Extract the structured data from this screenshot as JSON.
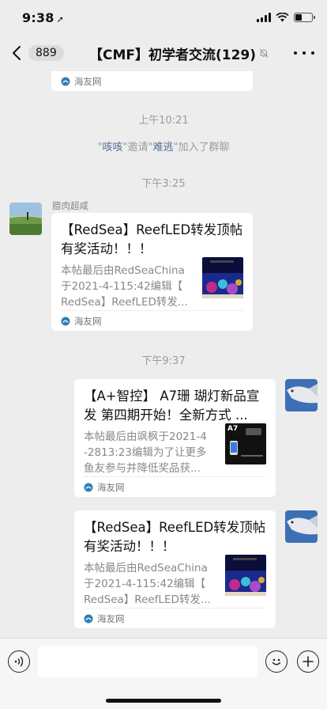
{
  "status_bar": {
    "time": "9:38",
    "location_arrow": "➚"
  },
  "nav": {
    "unread_count": "889",
    "title": "【CMF】初学者交流(129)"
  },
  "chat": {
    "messages": [
      {
        "type": "link_card_footer",
        "source": "海友网"
      },
      {
        "type": "timestamp",
        "text": "上午10:21"
      },
      {
        "type": "system",
        "q1": "\"",
        "inviter": "咳咳",
        "mid": "\"邀请\"",
        "invitee": "难逃",
        "end": "\"加入了群聊"
      },
      {
        "type": "timestamp",
        "text": "下午3:25"
      },
      {
        "type": "link_card",
        "sender": "腊肉超咸",
        "title_l1": "【RedSea】ReefLED转发顶帖",
        "title_l2": "有奖活动！！！",
        "desc_l1": "本帖最后由RedSeaChina",
        "desc_l2": "于2021-4-115:42编辑【",
        "desc_l3": "RedSea】ReefLED转发...",
        "source": "海友网"
      },
      {
        "type": "timestamp",
        "text": "下午9:37"
      },
      {
        "type": "link_card",
        "sender": "self",
        "title_l1": "【A+智控】 A7珊 瑚灯新品宣",
        "title_l2": "发  第四期开始！全新方式 ...",
        "desc_l1": "本帖最后由飒枫于2021-4",
        "desc_l2": "-2813:23编辑为了让更多",
        "desc_l3": "鱼友参与并降低奖品获...",
        "thumb_label": "A7",
        "source": "海友网"
      },
      {
        "type": "link_card",
        "sender": "self",
        "title_l1": "【RedSea】ReefLED转发顶帖",
        "title_l2": "有奖活动！！！",
        "desc_l1": "本帖最后由RedSeaChina",
        "desc_l2": "于2021-4-115:42编辑【",
        "desc_l3": "RedSea】ReefLED转发...",
        "source": "海友网"
      }
    ]
  },
  "input_bar": {
    "placeholder": ""
  },
  "icons": {
    "back": "chevron-left-icon",
    "mute": "bell-slash-icon",
    "more": "more-dots-icon",
    "voice": "voice-icon",
    "emoji": "emoji-icon",
    "plus": "plus-icon",
    "source": "haiyouwang-logo-icon"
  },
  "colors": {
    "background": "#ededed",
    "link_name": "#576b95",
    "input_bar": "#f6f6f6"
  }
}
